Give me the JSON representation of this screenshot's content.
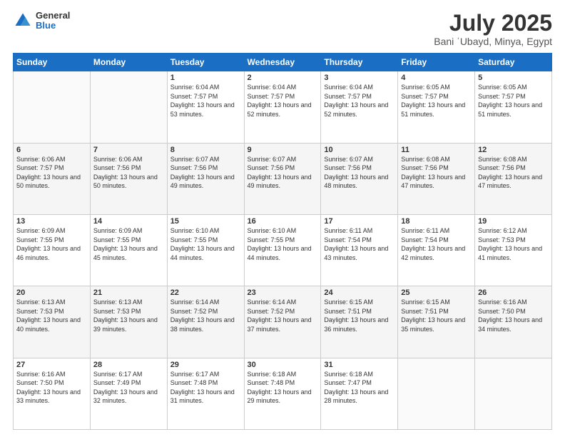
{
  "header": {
    "logo_general": "General",
    "logo_blue": "Blue",
    "title": "July 2025",
    "subtitle": "Bani ʿUbayd, Minya, Egypt"
  },
  "weekdays": [
    "Sunday",
    "Monday",
    "Tuesday",
    "Wednesday",
    "Thursday",
    "Friday",
    "Saturday"
  ],
  "weeks": [
    [
      {
        "day": "",
        "info": ""
      },
      {
        "day": "",
        "info": ""
      },
      {
        "day": "1",
        "info": "Sunrise: 6:04 AM\nSunset: 7:57 PM\nDaylight: 13 hours and 53 minutes."
      },
      {
        "day": "2",
        "info": "Sunrise: 6:04 AM\nSunset: 7:57 PM\nDaylight: 13 hours and 52 minutes."
      },
      {
        "day": "3",
        "info": "Sunrise: 6:04 AM\nSunset: 7:57 PM\nDaylight: 13 hours and 52 minutes."
      },
      {
        "day": "4",
        "info": "Sunrise: 6:05 AM\nSunset: 7:57 PM\nDaylight: 13 hours and 51 minutes."
      },
      {
        "day": "5",
        "info": "Sunrise: 6:05 AM\nSunset: 7:57 PM\nDaylight: 13 hours and 51 minutes."
      }
    ],
    [
      {
        "day": "6",
        "info": "Sunrise: 6:06 AM\nSunset: 7:57 PM\nDaylight: 13 hours and 50 minutes."
      },
      {
        "day": "7",
        "info": "Sunrise: 6:06 AM\nSunset: 7:56 PM\nDaylight: 13 hours and 50 minutes."
      },
      {
        "day": "8",
        "info": "Sunrise: 6:07 AM\nSunset: 7:56 PM\nDaylight: 13 hours and 49 minutes."
      },
      {
        "day": "9",
        "info": "Sunrise: 6:07 AM\nSunset: 7:56 PM\nDaylight: 13 hours and 49 minutes."
      },
      {
        "day": "10",
        "info": "Sunrise: 6:07 AM\nSunset: 7:56 PM\nDaylight: 13 hours and 48 minutes."
      },
      {
        "day": "11",
        "info": "Sunrise: 6:08 AM\nSunset: 7:56 PM\nDaylight: 13 hours and 47 minutes."
      },
      {
        "day": "12",
        "info": "Sunrise: 6:08 AM\nSunset: 7:56 PM\nDaylight: 13 hours and 47 minutes."
      }
    ],
    [
      {
        "day": "13",
        "info": "Sunrise: 6:09 AM\nSunset: 7:55 PM\nDaylight: 13 hours and 46 minutes."
      },
      {
        "day": "14",
        "info": "Sunrise: 6:09 AM\nSunset: 7:55 PM\nDaylight: 13 hours and 45 minutes."
      },
      {
        "day": "15",
        "info": "Sunrise: 6:10 AM\nSunset: 7:55 PM\nDaylight: 13 hours and 44 minutes."
      },
      {
        "day": "16",
        "info": "Sunrise: 6:10 AM\nSunset: 7:55 PM\nDaylight: 13 hours and 44 minutes."
      },
      {
        "day": "17",
        "info": "Sunrise: 6:11 AM\nSunset: 7:54 PM\nDaylight: 13 hours and 43 minutes."
      },
      {
        "day": "18",
        "info": "Sunrise: 6:11 AM\nSunset: 7:54 PM\nDaylight: 13 hours and 42 minutes."
      },
      {
        "day": "19",
        "info": "Sunrise: 6:12 AM\nSunset: 7:53 PM\nDaylight: 13 hours and 41 minutes."
      }
    ],
    [
      {
        "day": "20",
        "info": "Sunrise: 6:13 AM\nSunset: 7:53 PM\nDaylight: 13 hours and 40 minutes."
      },
      {
        "day": "21",
        "info": "Sunrise: 6:13 AM\nSunset: 7:53 PM\nDaylight: 13 hours and 39 minutes."
      },
      {
        "day": "22",
        "info": "Sunrise: 6:14 AM\nSunset: 7:52 PM\nDaylight: 13 hours and 38 minutes."
      },
      {
        "day": "23",
        "info": "Sunrise: 6:14 AM\nSunset: 7:52 PM\nDaylight: 13 hours and 37 minutes."
      },
      {
        "day": "24",
        "info": "Sunrise: 6:15 AM\nSunset: 7:51 PM\nDaylight: 13 hours and 36 minutes."
      },
      {
        "day": "25",
        "info": "Sunrise: 6:15 AM\nSunset: 7:51 PM\nDaylight: 13 hours and 35 minutes."
      },
      {
        "day": "26",
        "info": "Sunrise: 6:16 AM\nSunset: 7:50 PM\nDaylight: 13 hours and 34 minutes."
      }
    ],
    [
      {
        "day": "27",
        "info": "Sunrise: 6:16 AM\nSunset: 7:50 PM\nDaylight: 13 hours and 33 minutes."
      },
      {
        "day": "28",
        "info": "Sunrise: 6:17 AM\nSunset: 7:49 PM\nDaylight: 13 hours and 32 minutes."
      },
      {
        "day": "29",
        "info": "Sunrise: 6:17 AM\nSunset: 7:48 PM\nDaylight: 13 hours and 31 minutes."
      },
      {
        "day": "30",
        "info": "Sunrise: 6:18 AM\nSunset: 7:48 PM\nDaylight: 13 hours and 29 minutes."
      },
      {
        "day": "31",
        "info": "Sunrise: 6:18 AM\nSunset: 7:47 PM\nDaylight: 13 hours and 28 minutes."
      },
      {
        "day": "",
        "info": ""
      },
      {
        "day": "",
        "info": ""
      }
    ]
  ]
}
